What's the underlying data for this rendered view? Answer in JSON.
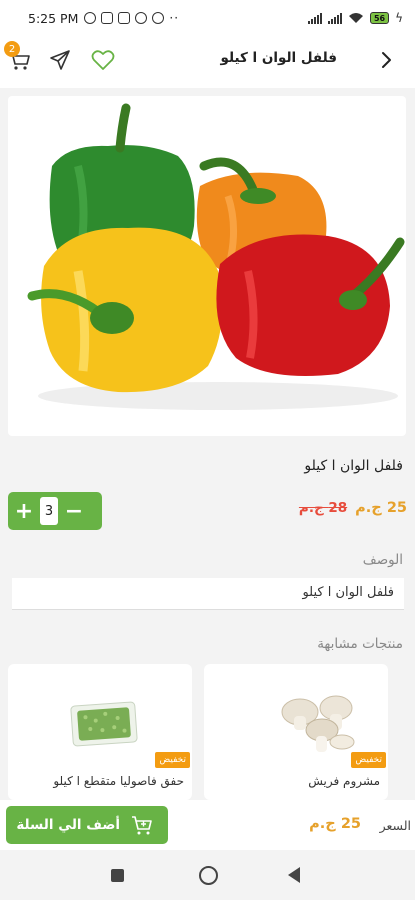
{
  "status_bar": {
    "time": "5:25 PM",
    "extra_indicators": "··",
    "battery": "56",
    "icons": [
      "alarm-icon",
      "sim-icon",
      "storage-icon",
      "whatsapp-icon",
      "settings-icon",
      "signal-icon",
      "wifi-icon",
      "battery-icon"
    ]
  },
  "header": {
    "title": "فلفل الوان ا كيلو",
    "cart_count": "2",
    "icons": [
      "cart-icon",
      "share-icon",
      "heart-icon",
      "back-arrow-icon"
    ]
  },
  "product": {
    "name": "فلفل الوان ا كيلو",
    "quantity": "3",
    "plus_label": "+",
    "minus_label": "−",
    "price_current": "25 ج.م",
    "price_old": "28 ج.م"
  },
  "description": {
    "heading": "الوصف",
    "text": "فلفل الوان ا كيلو"
  },
  "similar": {
    "heading": "منتجات مشابهة",
    "items": [
      {
        "title": "مشروم فريش",
        "badge": "تخفيض"
      },
      {
        "title": "حفق فاصوليا متقطع ا كيلو",
        "badge": "تخفيض"
      }
    ]
  },
  "bottom_bar": {
    "add_to_cart_label": "أضف الي السلة",
    "price": "25 ج.م",
    "price_label": "السعر"
  },
  "colors": {
    "accent_green": "#68b345",
    "price_orange": "#e6a12b",
    "old_price_red": "#e74c3c",
    "badge_orange": "#f39c12"
  }
}
